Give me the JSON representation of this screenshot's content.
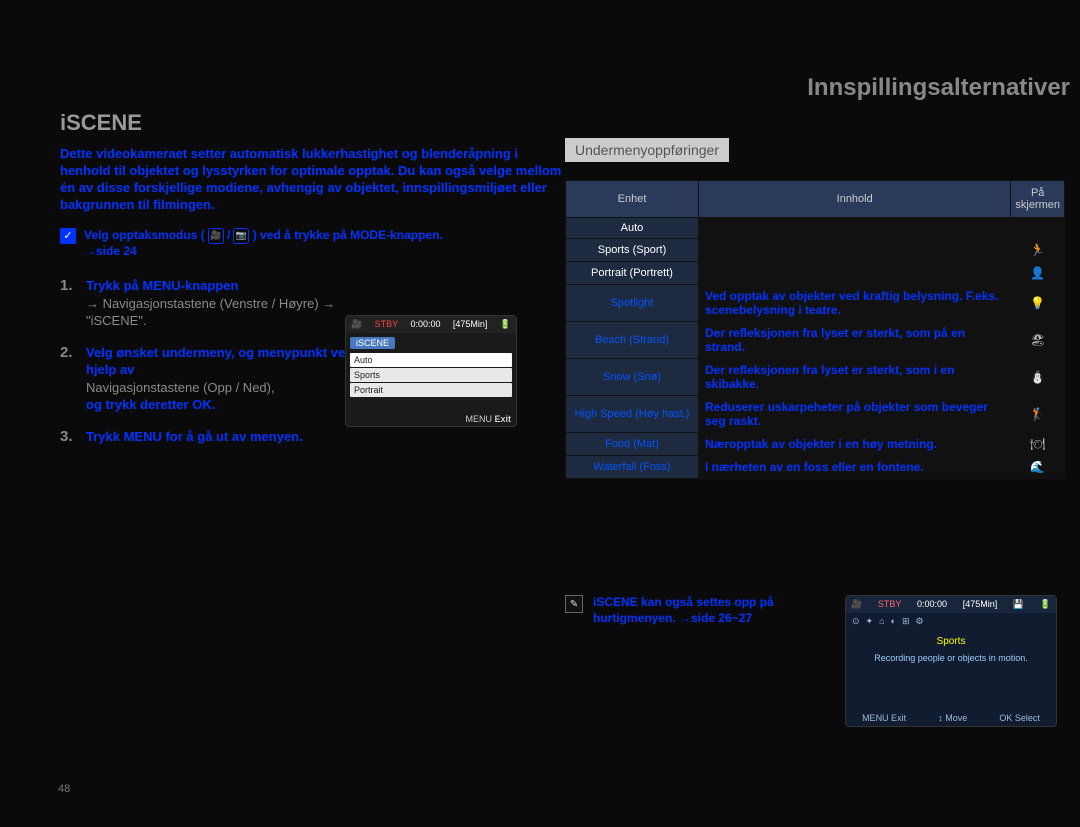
{
  "header": "Innspillingsalternativer",
  "title": "iSCENE",
  "intro": "Dette videokameraet setter automatisk lukkerhastighet og blenderåpning i henhold til objektet og lysstyrken for optimale opptak. Du kan også velge mellom én av disse forskjellige modiene, avhengig av objektet, innspillingsmiljøet eller bakgrunnen til filmingen.",
  "note": {
    "glyph": "✓",
    "text_a": "Velg opptaksmodus (",
    "text_b": ") ved å trykke på MODE-knappen.",
    "text_c": "→side 24"
  },
  "steps": {
    "s1": {
      "num": "1.",
      "b": "Trykk på MENU-knappen",
      "p1": "→ Navigasjonstastene (Venstre / Høyre) → \"iSCENE\"."
    },
    "s2": {
      "num": "2.",
      "b": "Velg ønsket undermeny, og menypunkt ved hjelp av",
      "p1": "Navigasjonstastene (Opp / Ned),",
      "b2": "og trykk deretter OK."
    },
    "s3": {
      "num": "3.",
      "b": "Trykk MENU for å gå ut av menyen."
    }
  },
  "screen1": {
    "stby": "STBY",
    "time": "0:00:00",
    "remain": "[475Min]",
    "tab": "iSCENE",
    "items": [
      "Auto",
      "Sports",
      "Portrait"
    ],
    "foot_menu": "MENU",
    "foot_exit": "Exit"
  },
  "subhead": "Undermenyoppføringer",
  "table": {
    "h1": "Enhet",
    "h2": "Innhold",
    "h3": "På skjermen",
    "rows": [
      {
        "name": "Auto",
        "white": true,
        "desc": "",
        "icon": ""
      },
      {
        "name": "Sports (Sport)",
        "white": true,
        "desc": "",
        "icon": "🏃"
      },
      {
        "name": "Portrait (Portrett)",
        "white": true,
        "desc": "",
        "icon": "👤"
      },
      {
        "name": "Spotlight",
        "white": false,
        "desc": "Ved opptak av objekter ved kraftig belysning. F.eks. scenebelysning i teatre.",
        "icon": "💡"
      },
      {
        "name": "Beach (Strand)",
        "white": false,
        "desc": "Der refleksjonen fra lyset er sterkt, som på en strand.",
        "icon": "🏖"
      },
      {
        "name": "Snow (Snø)",
        "white": false,
        "desc": "Der refleksjonen fra lyset er sterkt, som i en skibakke.",
        "icon": "⛄"
      },
      {
        "name": "High Speed (Høy hast.)",
        "white": false,
        "desc": "Reduserer uskarpeheter på objekter som beveger seg raskt.",
        "icon": "🏌"
      },
      {
        "name": "Food (Mat)",
        "white": false,
        "desc": "Næropptak av objekter i en høy metning.",
        "icon": "🍽"
      },
      {
        "name": "Waterfall (Foss)",
        "white": false,
        "desc": "I nærheten av en foss eller en fontene.",
        "icon": "🌊"
      }
    ]
  },
  "tip": {
    "glyph": "✎",
    "text": "iSCENE kan også settes opp på hurtigmenyen. →side 26~27"
  },
  "screen2": {
    "stby": "STBY",
    "time": "0:00:00",
    "remain": "[475Min]",
    "center": "Sports",
    "desc": "Recording people or objects in motion.",
    "foot": [
      "MENU Exit",
      "↕ Move",
      "OK Select"
    ]
  },
  "pagenum": "48"
}
